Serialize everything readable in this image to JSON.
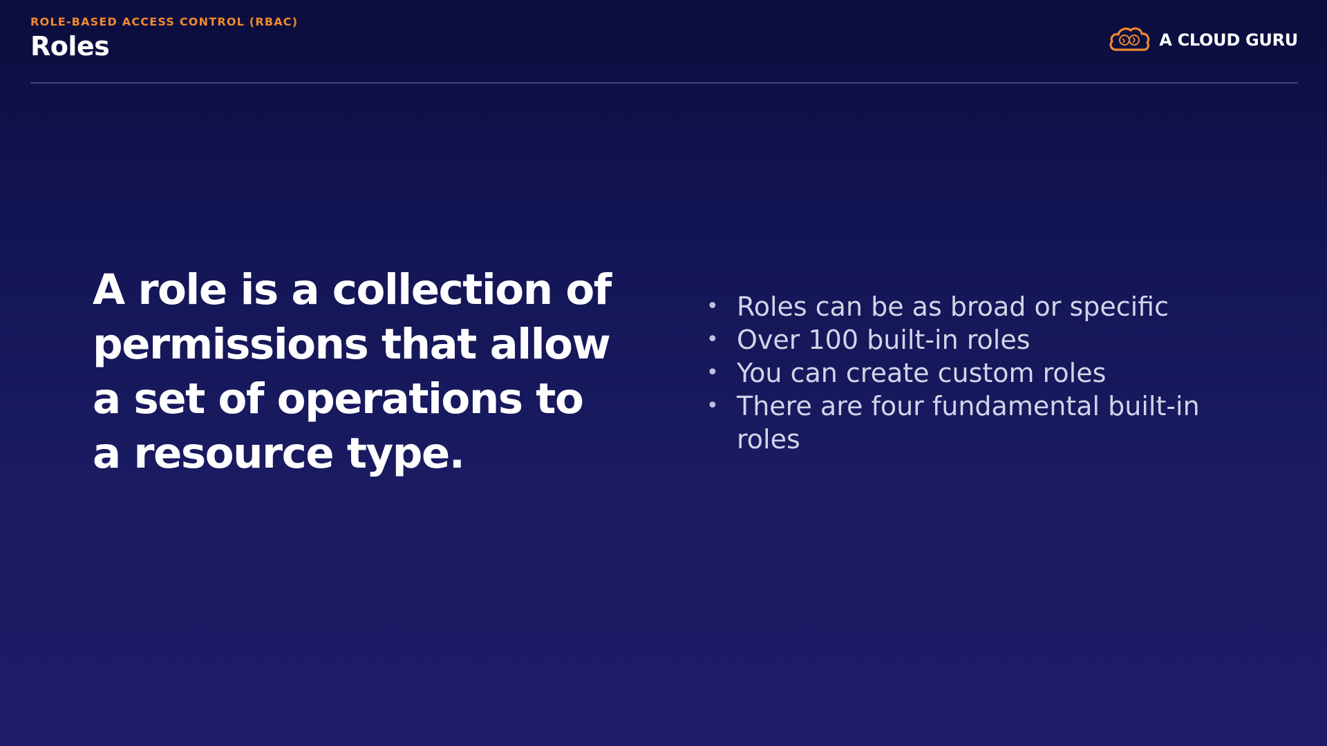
{
  "header": {
    "eyebrow": "ROLE-BASED ACCESS CONTROL (RBAC)",
    "title": "Roles"
  },
  "brand": {
    "name": "A CLOUD GURU",
    "logo_icon": "cloud-logo-icon",
    "logo_color": "#f08a2e"
  },
  "main": {
    "statement": "A role is a collection of permissions that allow a set of operations to a resource type.",
    "bullets": [
      "Roles can be as broad or specific",
      "Over 100 built-in roles",
      "You can create custom roles",
      "There are four fundamental built-in roles"
    ]
  },
  "colors": {
    "accent": "#f08a2e",
    "background": "#1a1b62",
    "text": "#ffffff",
    "bullet_text": "#d3d4e9"
  }
}
